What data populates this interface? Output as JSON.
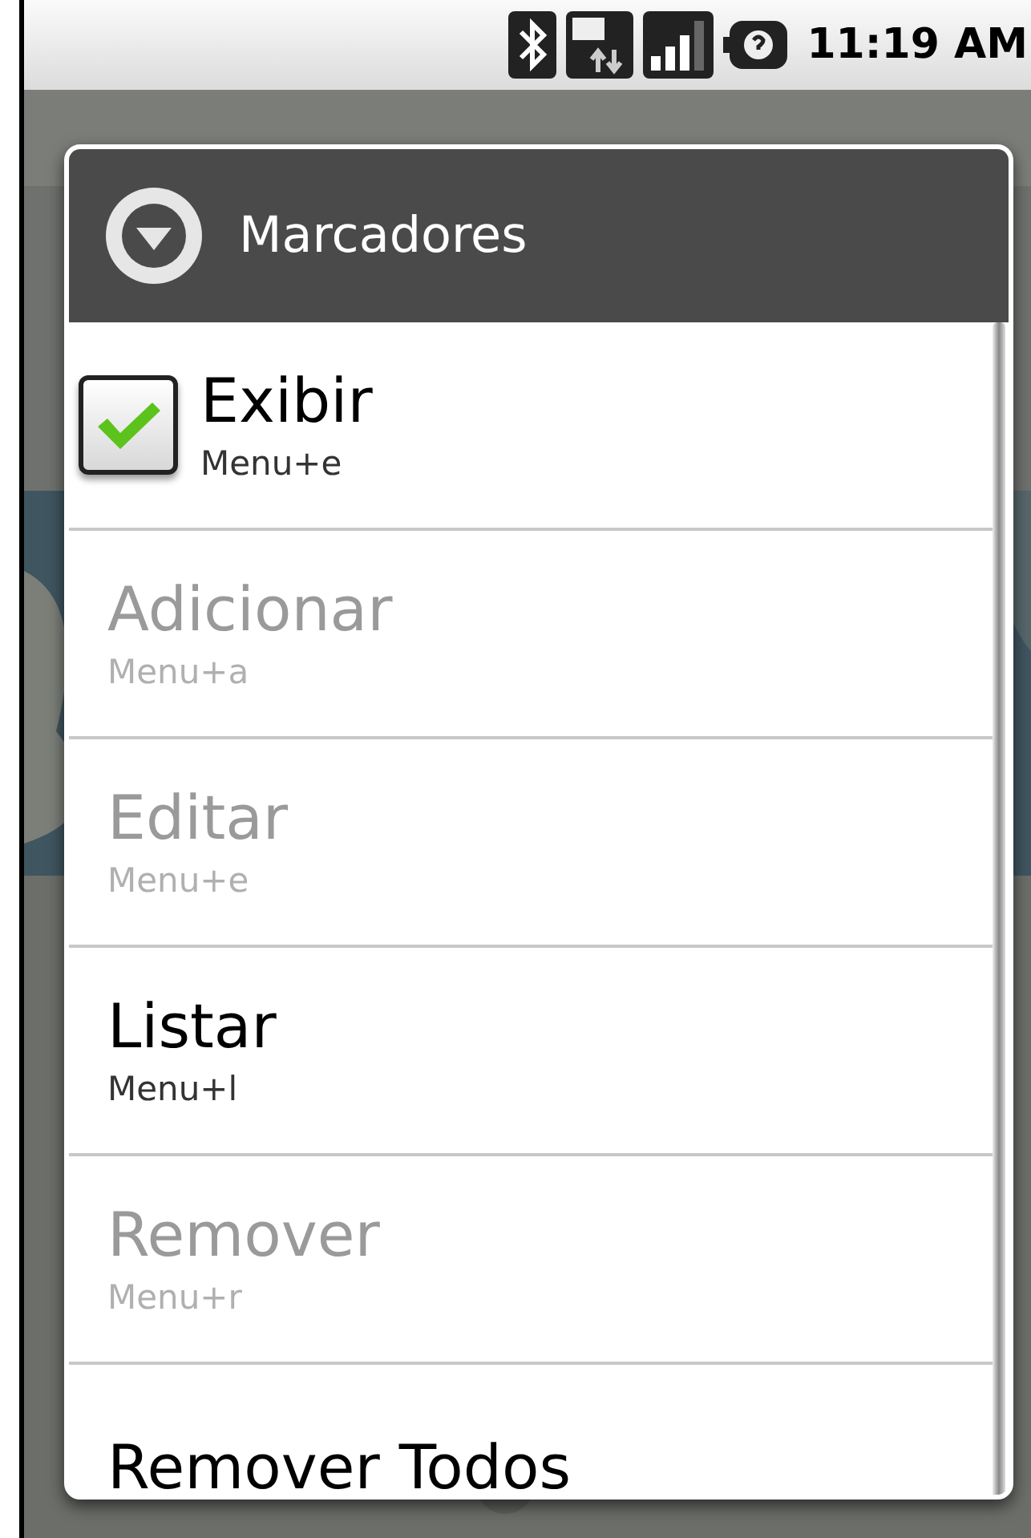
{
  "status_bar": {
    "time": "11:19 AM"
  },
  "dialog": {
    "title": "Marcadores",
    "items": [
      {
        "kind": "checkbox",
        "label": "Exibir",
        "shortcut": "Menu+e",
        "checked": true,
        "disabled": false
      },
      {
        "kind": "plain",
        "label": "Adicionar",
        "shortcut": "Menu+a",
        "disabled": true
      },
      {
        "kind": "plain",
        "label": "Editar",
        "shortcut": "Menu+e",
        "disabled": true
      },
      {
        "kind": "plain",
        "label": "Listar",
        "shortcut": "Menu+l",
        "disabled": false
      },
      {
        "kind": "plain",
        "label": "Remover",
        "shortcut": "Menu+r",
        "disabled": true
      },
      {
        "kind": "plain",
        "label": "Remover Todos",
        "disabled": false
      }
    ]
  }
}
